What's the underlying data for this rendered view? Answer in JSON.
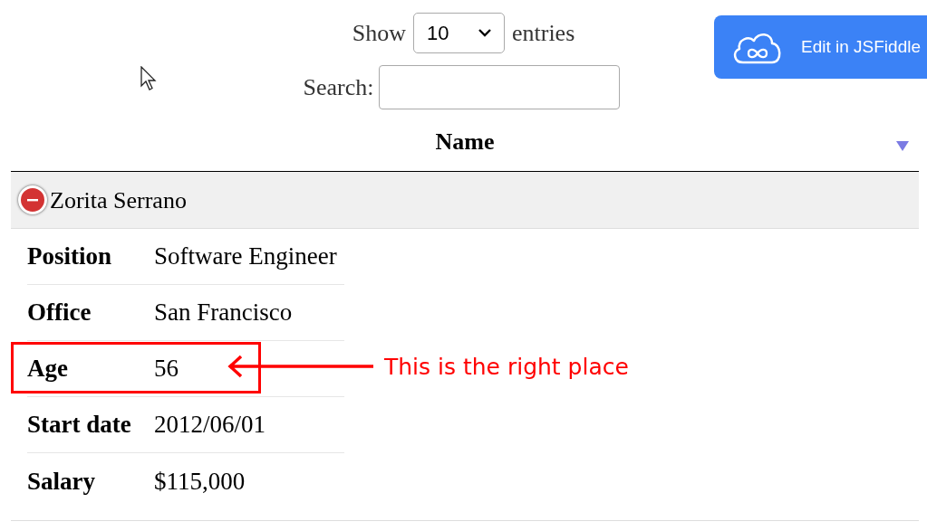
{
  "length_menu": {
    "label_before": "Show",
    "value": "10",
    "label_after": "entries"
  },
  "search": {
    "label": "Search:"
  },
  "edit_button": {
    "label": "Edit in JSFiddle"
  },
  "table": {
    "columns": [
      {
        "label": "Name",
        "sorted_descending": true
      }
    ],
    "rows": [
      {
        "name": "Zorita Serrano",
        "expanded": true,
        "details": [
          {
            "label": "Position",
            "value": "Software Engineer",
            "highlighted": false
          },
          {
            "label": "Office",
            "value": "San Francisco",
            "highlighted": false
          },
          {
            "label": "Age",
            "value": "56",
            "highlighted": true
          },
          {
            "label": "Start date",
            "value": "2012/06/01",
            "highlighted": false
          },
          {
            "label": "Salary",
            "value": "$115,000",
            "highlighted": false
          }
        ]
      }
    ]
  },
  "annotation": {
    "text": "This is the right place"
  }
}
